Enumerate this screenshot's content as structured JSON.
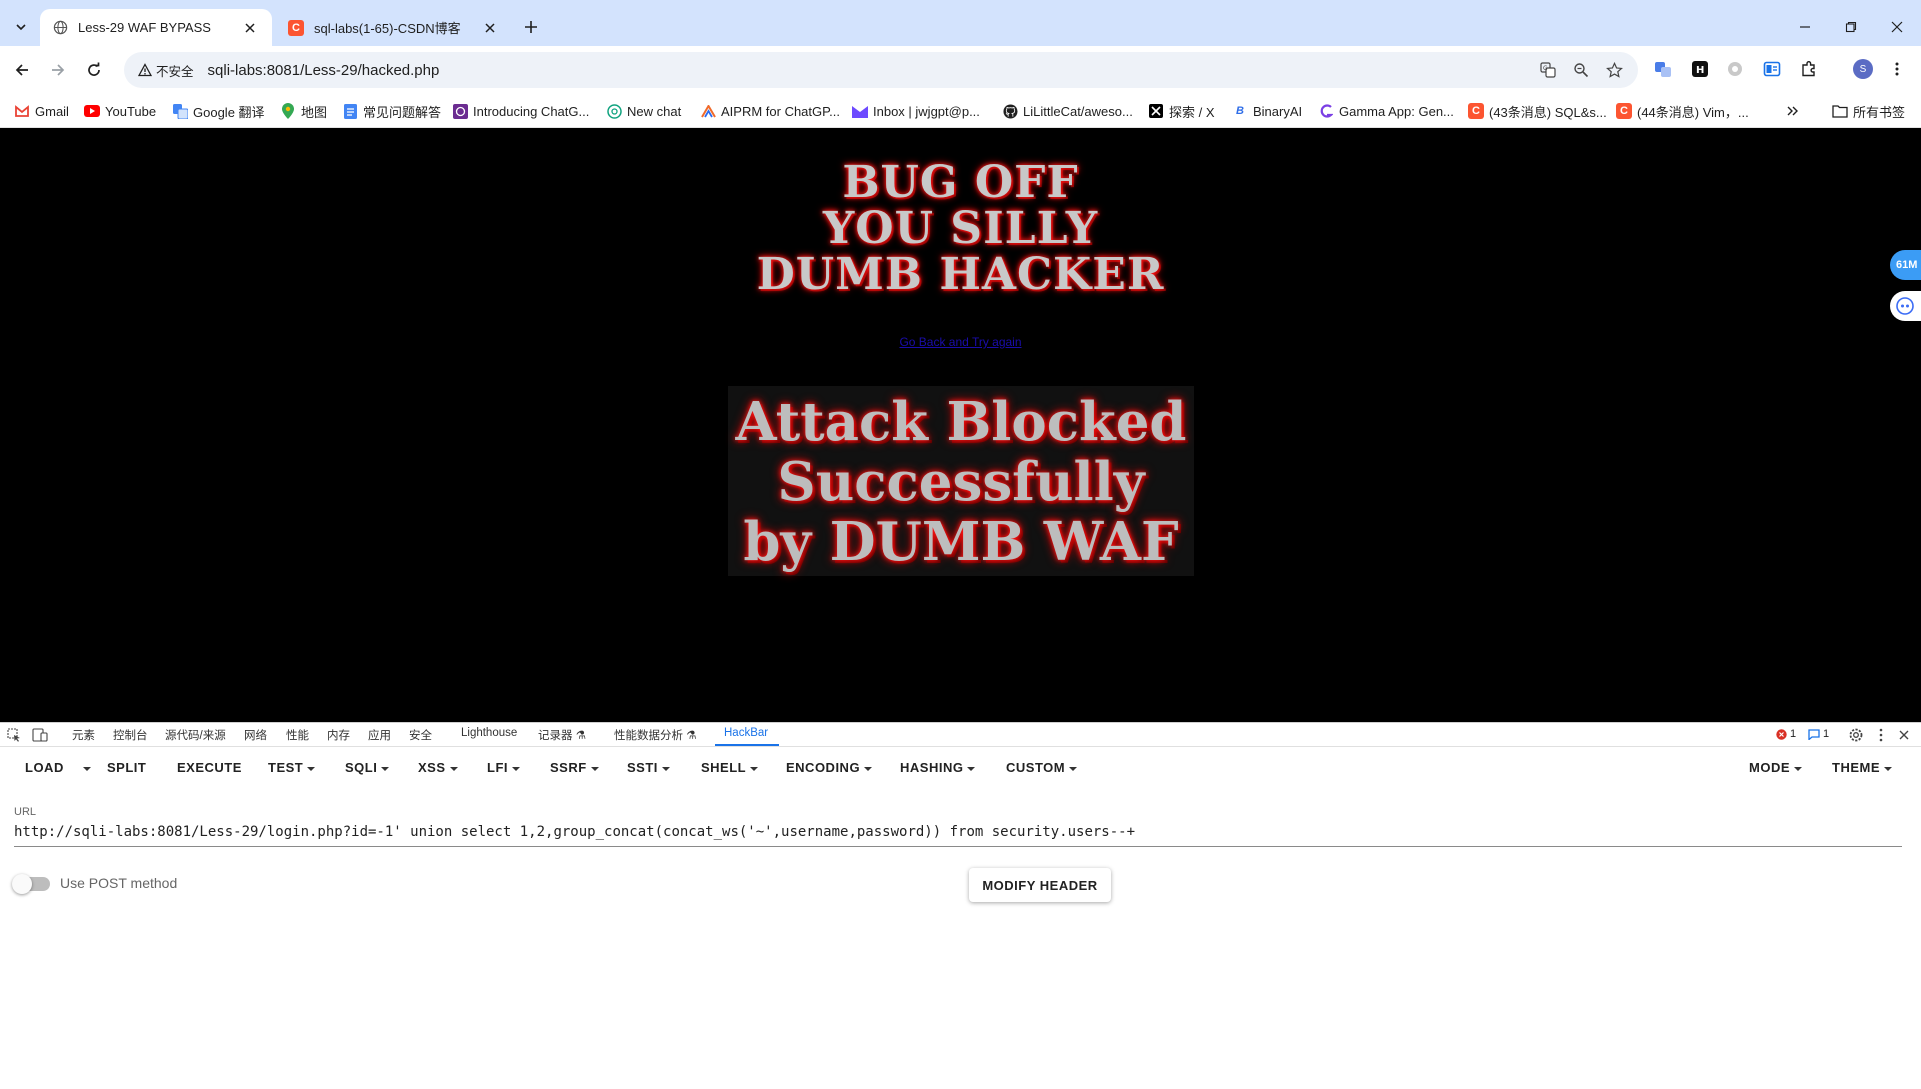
{
  "browser": {
    "tabs": [
      {
        "title": "Less-29 WAF BYPASS",
        "active": true
      },
      {
        "title": "sql-labs(1-65)-CSDN博客",
        "active": false
      }
    ],
    "security_label": "不安全",
    "address": "sqli-labs:8081/Less-29/hacked.php",
    "profile_initial": "S"
  },
  "bookmarks": {
    "items": [
      {
        "label": "Gmail",
        "icon": "gmail-icon",
        "color": "#ea4335"
      },
      {
        "label": "YouTube",
        "icon": "youtube-icon",
        "color": "#ff0000"
      },
      {
        "label": "Google 翻译",
        "icon": "translate-icon",
        "color": "#4285f4"
      },
      {
        "label": "地图",
        "icon": "maps-pin-icon",
        "color": "#34a853"
      },
      {
        "label": "常见问题解答",
        "icon": "doc-icon",
        "color": "#4285f4"
      },
      {
        "label": "Introducing ChatG...",
        "icon": "openai-icon",
        "color": "#6b2c91"
      },
      {
        "label": "New chat",
        "icon": "chatgpt-icon",
        "color": "#10a37f"
      },
      {
        "label": "AIPRM for ChatGP...",
        "icon": "aiprm-icon",
        "color": "#f06a2b"
      },
      {
        "label": "Inbox | jwjgpt@p...",
        "icon": "proton-mail-icon",
        "color": "#6d4aff"
      },
      {
        "label": "LiLittleCat/aweso...",
        "icon": "github-icon",
        "color": "#1f1f1f"
      },
      {
        "label": "探索 / X",
        "icon": "x-icon",
        "color": "#000000"
      },
      {
        "label": "BinaryAI",
        "icon": "binaryai-icon",
        "color": "#2f6ee8"
      },
      {
        "label": "Gamma App: Gen...",
        "icon": "gamma-icon",
        "color": "#7b3fe4"
      },
      {
        "label": "(43条消息) SQL&s...",
        "icon": "csdn-icon",
        "color": "#fc5531"
      },
      {
        "label": "(44条消息) Vim，...",
        "icon": "csdn-icon",
        "color": "#fc5531"
      }
    ],
    "all_bookmarks": "所有书签"
  },
  "page": {
    "title_lines": [
      "BUG OFF",
      "YOU SILLY",
      "DUMB HACKER"
    ],
    "go_back_link": "Go Back and Try again",
    "blocked_lines": [
      "Attack Blocked",
      "Successfully",
      "by DUMB WAF"
    ],
    "side_badge": "61M"
  },
  "devtools": {
    "tabs": [
      "元素",
      "控制台",
      "源代码/来源",
      "网络",
      "性能",
      "内存",
      "应用",
      "安全",
      "Lighthouse",
      "记录器 ⚗",
      "性能数据分析 ⚗",
      "HackBar"
    ],
    "active_tab": "HackBar",
    "error_count": "1",
    "message_count": "1"
  },
  "hackbar": {
    "menu_left": [
      "LOAD",
      "SPLIT",
      "EXECUTE",
      "TEST",
      "SQLI",
      "XSS",
      "LFI",
      "SSRF",
      "SSTI",
      "SHELL",
      "ENCODING",
      "HASHING",
      "CUSTOM"
    ],
    "menu_right": [
      "MODE",
      "THEME"
    ],
    "url_label": "URL",
    "url_value": "http://sqli-labs:8081/Less-29/login.php?id=-1' union select 1,2,group_concat(concat_ws('~',username,password)) from security.users--+",
    "post_label": "Use POST method",
    "modify_header": "MODIFY HEADER"
  }
}
